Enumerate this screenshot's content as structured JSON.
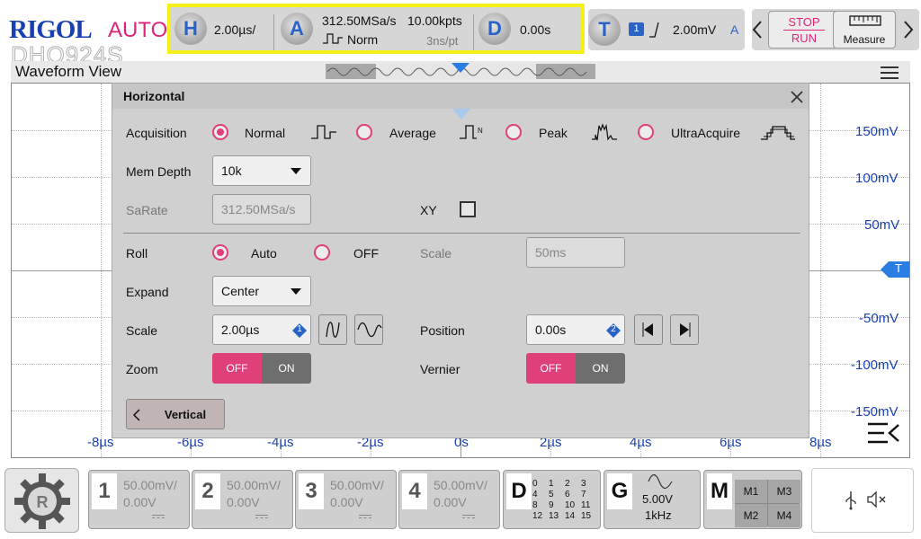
{
  "brand": {
    "logo": "RIGOL",
    "mode": "AUTO",
    "model": "DHO924S"
  },
  "topbar": {
    "horizontal": {
      "letter": "H",
      "timebase": "2.00µs/"
    },
    "acquire": {
      "letter": "A",
      "sample_rate": "312.50MSa/s",
      "points": "10.00kpts",
      "mode": "Norm",
      "time_per_pt": "3ns/pt"
    },
    "delay": {
      "letter": "D",
      "value": "0.00s"
    },
    "trigger": {
      "letter": "T",
      "channel": "1",
      "level": "2.00mV",
      "mode": "A"
    },
    "run": {
      "stop_label": "STOP",
      "run_label": "RUN",
      "measure_label": "Measure"
    }
  },
  "waveform": {
    "title": "Waveform View",
    "y_labels": [
      "150mV",
      "100mV",
      "50mV",
      "-50mV",
      "-100mV",
      "-150mV"
    ],
    "x_labels": [
      "-8µs",
      "-6µs",
      "-4µs",
      "-2µs",
      "0s",
      "2µs",
      "4µs",
      "6µs",
      "8µs"
    ],
    "trigger_marker": "T",
    "colors": {
      "axis_label": "#1a3fb0",
      "marker": "#2a7de1"
    }
  },
  "dialog": {
    "title": "Horizontal",
    "acquisition": {
      "label": "Acquisition",
      "options": [
        "Normal",
        "Average",
        "Peak",
        "UltraAcquire"
      ],
      "selected": "Normal",
      "average_badge": "N"
    },
    "mem_depth": {
      "label": "Mem Depth",
      "value": "10k"
    },
    "sa_rate": {
      "label": "SaRate",
      "value": "312.50MSa/s"
    },
    "xy": {
      "label": "XY",
      "checked": false
    },
    "roll": {
      "label": "Roll",
      "options": [
        "Auto",
        "OFF"
      ],
      "selected": "Auto"
    },
    "roll_scale": {
      "label": "Scale",
      "value": "50ms"
    },
    "expand": {
      "label": "Expand",
      "value": "Center"
    },
    "scale": {
      "label": "Scale",
      "value": "2.00µs",
      "knob": "1"
    },
    "position": {
      "label": "Position",
      "value": "0.00s",
      "knob": "2"
    },
    "zoom": {
      "label": "Zoom",
      "off": "OFF",
      "on": "ON",
      "state": "OFF"
    },
    "vernier": {
      "label": "Vernier",
      "off": "OFF",
      "on": "ON",
      "state": "OFF"
    },
    "vertical_button": "Vertical",
    "colors": {
      "accent": "#e0407a",
      "knob": "#2a63c8"
    }
  },
  "channels": [
    {
      "num": "1",
      "scale": "50.00mV/",
      "offset": "0.00V"
    },
    {
      "num": "2",
      "scale": "50.00mV/",
      "offset": "0.00V"
    },
    {
      "num": "3",
      "scale": "50.00mV/",
      "offset": "0.00V"
    },
    {
      "num": "4",
      "scale": "50.00mV/",
      "offset": "0.00V"
    }
  ],
  "digital": {
    "letter": "D",
    "grid": [
      "0",
      "1",
      "2",
      "3",
      "4",
      "5",
      "6",
      "7",
      "8",
      "9",
      "10",
      "11",
      "12",
      "13",
      "14",
      "15"
    ]
  },
  "generator": {
    "letter": "G",
    "amplitude": "5.00V",
    "frequency": "1kHz"
  },
  "math": {
    "letter": "M",
    "items": [
      "M1",
      "M3",
      "M2",
      "M4"
    ]
  },
  "status": {
    "usb_icon": "usb-icon",
    "mute_icon": "mute-icon"
  }
}
